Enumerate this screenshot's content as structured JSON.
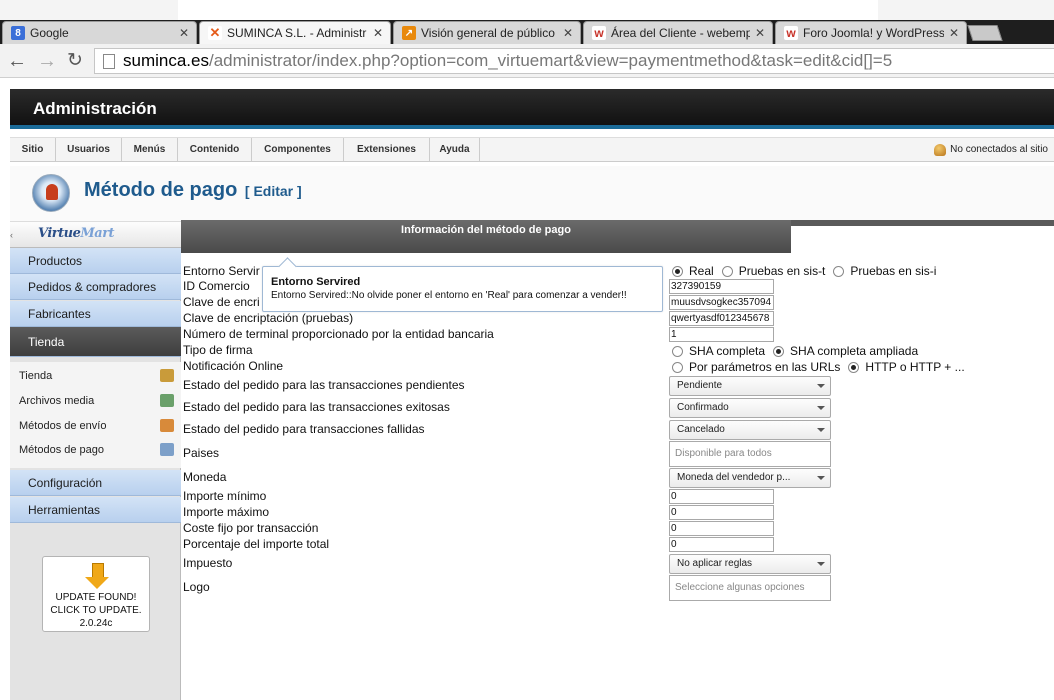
{
  "browser": {
    "tabs": [
      {
        "title": "Google",
        "favicon": "google-favicon",
        "color": "#3b6fd8",
        "glyph": "8"
      },
      {
        "title": "SUMINCA S.L. - Administr",
        "favicon": "joomla-favicon",
        "color": "#e55b1a",
        "glyph": "✕"
      },
      {
        "title": "Visión general de público",
        "favicon": "analytics-favicon",
        "color": "#e8890c",
        "glyph": "↗"
      },
      {
        "title": "Área del Cliente - webemp",
        "favicon": "webempresa-favicon",
        "color": "#c8342b",
        "glyph": "w"
      },
      {
        "title": "Foro Joomla! y WordPress",
        "favicon": "webempresa-favicon",
        "color": "#c8342b",
        "glyph": "w"
      }
    ],
    "close_glyph": "✕",
    "back_glyph": "←",
    "forward_glyph": "→",
    "reload_glyph": "↻",
    "url_host": "suminca.es",
    "url_path": "/administrator/index.php?option=com_virtuemart&view=paymentmethod&task=edit&cid[]=5"
  },
  "admin": {
    "title": "Administración",
    "menu": [
      "Sitio",
      "Usuarios",
      "Menús",
      "Contenido",
      "Componentes",
      "Extensiones",
      "Ayuda"
    ],
    "status": "No conectados al sitio"
  },
  "page": {
    "title": "Método de pago",
    "subtitle": "[ Editar ]"
  },
  "sidebar": {
    "brand_a": "Virtue",
    "brand_b": "Mart",
    "collapse_glyph": "‹",
    "sections_top": [
      "Productos",
      "Pedidos & compradores",
      "Fabricantes",
      "Tienda"
    ],
    "active_section": "Tienda",
    "sub_items": [
      {
        "label": "Tienda",
        "icon": "store-icon",
        "color": "#c99b3a"
      },
      {
        "label": "Archivos media",
        "icon": "media-icon",
        "color": "#6aa06a"
      },
      {
        "label": "Métodos de envío",
        "icon": "shipping-icon",
        "color": "#d88a3a"
      },
      {
        "label": "Métodos de pago",
        "icon": "payment-icon",
        "color": "#7da0c9"
      }
    ],
    "sections_bottom": [
      "Configuración",
      "Herramientas"
    ],
    "update": {
      "line1": "UPDATE FOUND!",
      "line2": "CLICK TO UPDATE.",
      "version": "2.0.24c"
    }
  },
  "form": {
    "section_title": "Información del método de pago",
    "fields": {
      "entorno_label": "Entorno Servir",
      "id_comercio_label": "ID Comercio",
      "clave_label": "Clave de encri",
      "clave_pruebas_label": "Clave de encriptación (pruebas)",
      "terminal_label": "Número de terminal proporcionado por la entidad bancaria",
      "tipo_firma_label": "Tipo de firma",
      "notificacion_label": "Notificación Online",
      "estado_pendientes_label": "Estado del pedido para las transacciones pendientes",
      "estado_exitosas_label": "Estado del pedido para las transacciones exitosas",
      "estado_fallidas_label": "Estado del pedido para transacciones fallidas",
      "paises_label": "Paises",
      "moneda_label": "Moneda",
      "importe_minimo_label": "Importe mínimo",
      "importe_maximo_label": "Importe máximo",
      "coste_fijo_label": "Coste fijo por transacción",
      "porcentaje_label": "Porcentaje del importe total",
      "impuesto_label": "Impuesto",
      "logo_label": "Logo"
    },
    "values": {
      "entorno_options": [
        "Real",
        "Pruebas en sis-t",
        "Pruebas en sis-i"
      ],
      "entorno_selected": 0,
      "id_comercio": "327390159",
      "clave": "muusdvsogkec357094",
      "clave_pruebas": "qwertyasdf012345678",
      "terminal": "1",
      "firma_options": [
        "SHA completa",
        "SHA completa ampliada"
      ],
      "firma_selected": 1,
      "notificacion_options": [
        "Por parámetros en las URLs",
        "HTTP o HTTP + ..."
      ],
      "notificacion_selected": 1,
      "estado_pendientes": "Pendiente",
      "estado_exitosas": "Confirmado",
      "estado_fallidas": "Cancelado",
      "paises_placeholder": "Disponible para todos",
      "moneda": "Moneda del vendedor p...",
      "importe_minimo": "0",
      "importe_maximo": "0",
      "coste_fijo": "0",
      "porcentaje": "0",
      "impuesto": "No aplicar reglas",
      "logo_placeholder": "Seleccione algunas opciones"
    },
    "tooltip": {
      "title": "Entorno Servired",
      "body": "Entorno Servired::No olvide poner el entorno en 'Real' para comenzar a vender!!"
    }
  }
}
